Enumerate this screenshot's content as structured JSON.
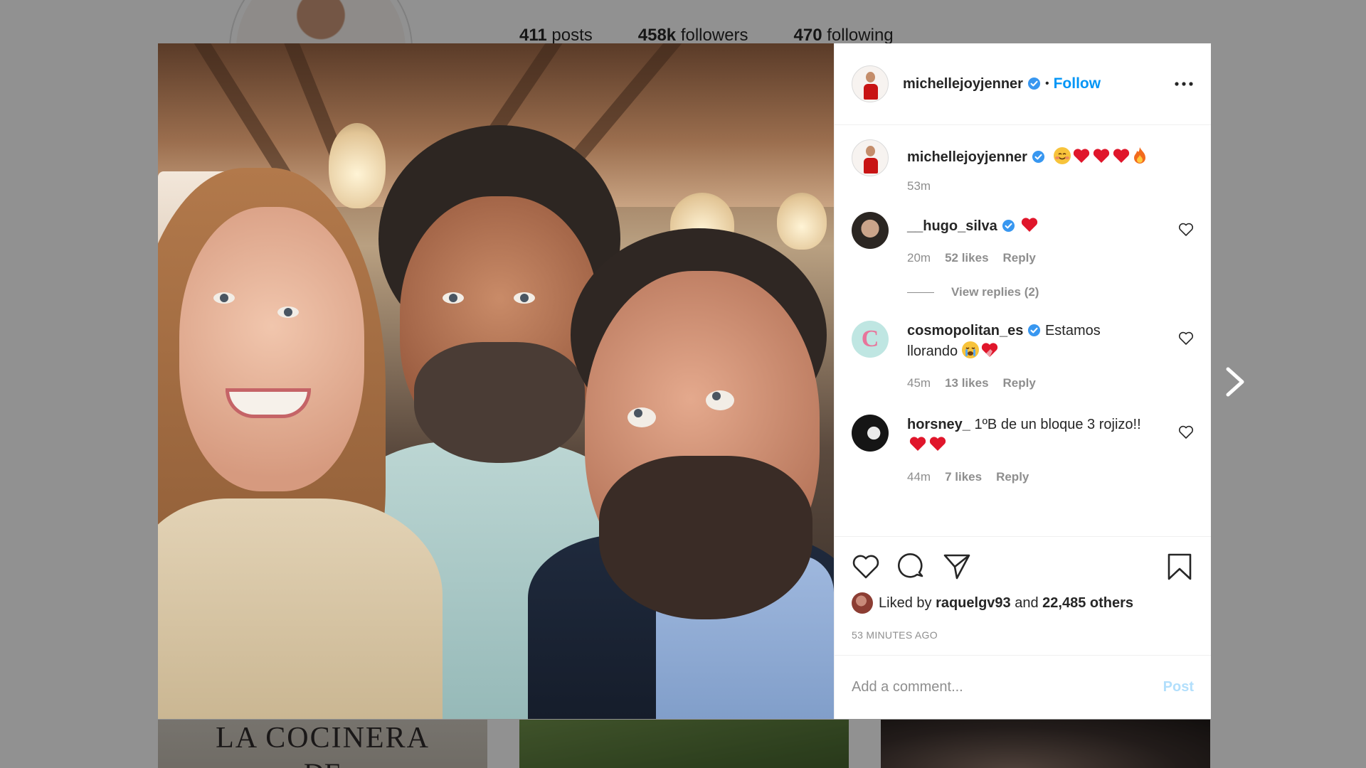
{
  "profile": {
    "stats": [
      {
        "count": "411",
        "label": "posts"
      },
      {
        "count": "458k",
        "label": "followers"
      },
      {
        "count": "470",
        "label": "following"
      }
    ],
    "tile_text_line1": "LA COCINERA",
    "tile_text_line2": "DE"
  },
  "post": {
    "username": "michellejoyjenner",
    "follow_label": "Follow",
    "caption_time": "53m",
    "comments": [
      {
        "user": "__hugo_silva",
        "verified": true,
        "text": "",
        "time": "20m",
        "likes": "52 likes",
        "reply": "Reply",
        "view_replies": "View replies (2)"
      },
      {
        "user": "cosmopolitan_es",
        "verified": true,
        "text": "Estamos llorando",
        "time": "45m",
        "likes": "13 likes",
        "reply": "Reply"
      },
      {
        "user": "horsney_",
        "verified": false,
        "text": "1ºB de un bloque 3 rojizo!!",
        "time": "44m",
        "likes": "7 likes",
        "reply": "Reply"
      }
    ],
    "liked_prefix": "Liked by",
    "liked_user": "raquelgv93",
    "liked_and": "and",
    "liked_others": "22,485 others",
    "time_ago": "53 MINUTES AGO",
    "comment_placeholder": "Add a comment...",
    "post_label": "Post"
  },
  "colors": {
    "accent": "#0095f6",
    "verified": "#3897f0",
    "heart": "#ed4956"
  },
  "icons": [
    "verified-badge-icon",
    "more-options-icon",
    "like-heart-icon",
    "comment-icon",
    "share-icon",
    "bookmark-icon",
    "next-arrow-icon"
  ]
}
